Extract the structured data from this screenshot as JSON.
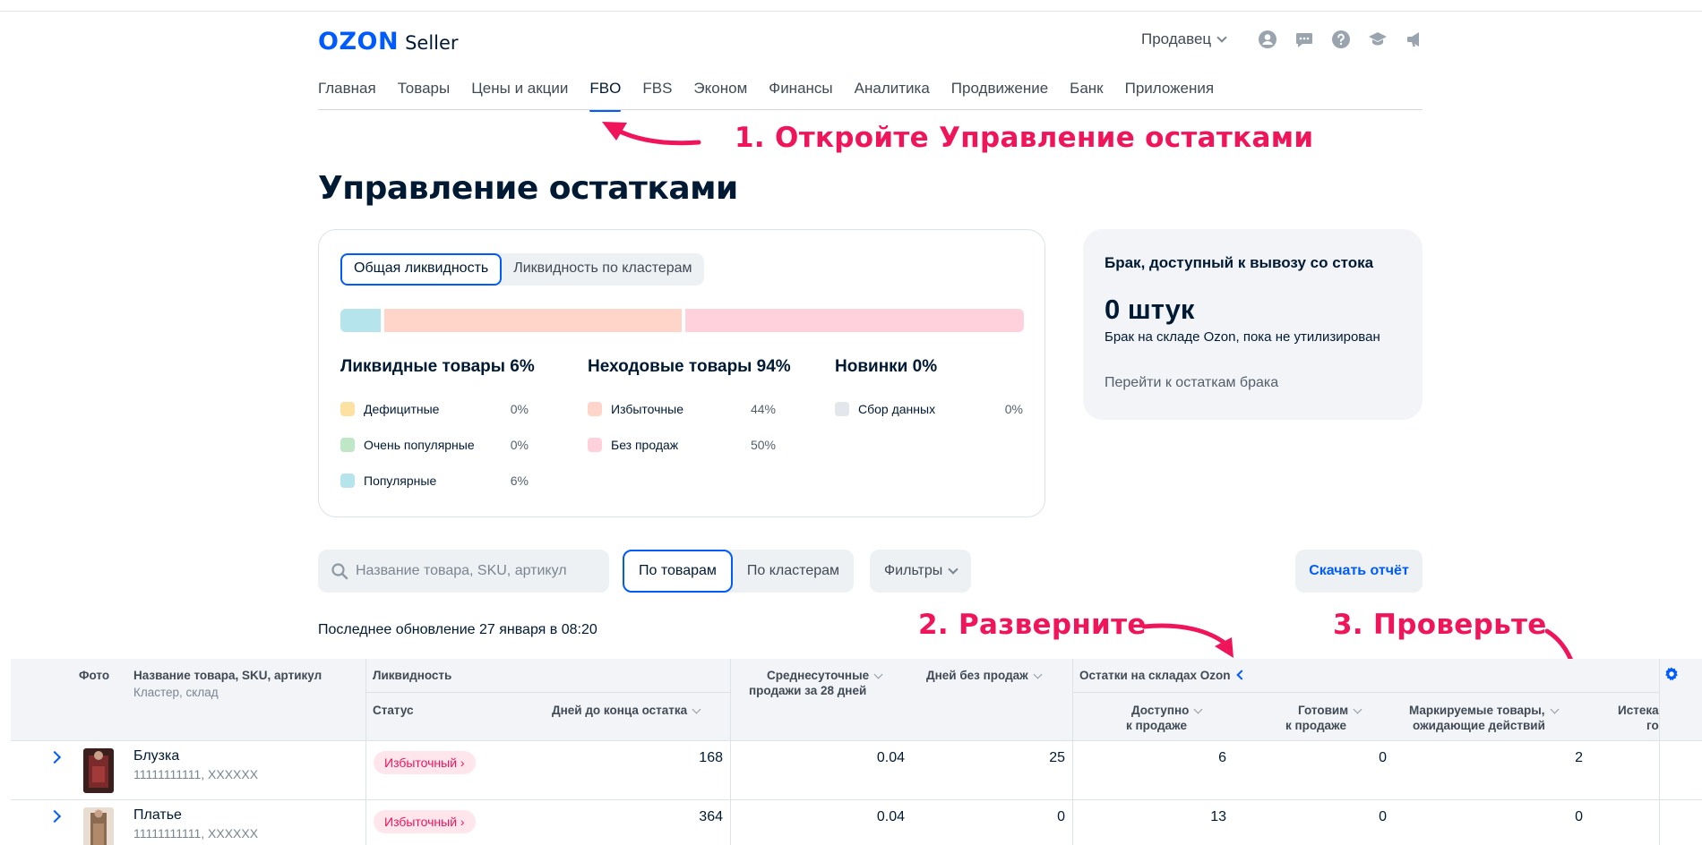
{
  "header": {
    "logo_brand": "OZON",
    "logo_product": "Seller",
    "seller_menu": "Продавец",
    "icons": [
      "user-icon",
      "chat-icon",
      "help-icon",
      "education-icon",
      "announcement-icon"
    ]
  },
  "nav": {
    "items": [
      "Главная",
      "Товары",
      "Цены и акции",
      "FBO",
      "FBS",
      "Эконом",
      "Финансы",
      "Аналитика",
      "Продвижение",
      "Банк",
      "Приложения"
    ],
    "active": "FBO"
  },
  "annotations": {
    "step1": "1. Откройте Управление остатками",
    "step2": "2. Разверните",
    "step3": "3. Проверьте"
  },
  "page": {
    "title": "Управление остатками"
  },
  "liquidity": {
    "tabs": [
      "Общая ликвидность",
      "Ликвидность по кластерам"
    ],
    "active_tab": "Общая ликвидность",
    "bar_segments": [
      {
        "name": "Популярные",
        "fraction": 0.06,
        "color": "#b6e4ec"
      },
      {
        "name": "Избыточные",
        "fraction": 0.44,
        "color": "#ffd4c9"
      },
      {
        "name": "Без продаж",
        "fraction": 0.5,
        "color": "#ffd1dd"
      }
    ],
    "groups": [
      {
        "title": "Ликвидные товары 6%",
        "items": [
          {
            "label": "Дефицитные",
            "pct": "0%",
            "color": "#fde1a0"
          },
          {
            "label": "Очень популярные",
            "pct": "0%",
            "color": "#bfe6c7"
          },
          {
            "label": "Популярные",
            "pct": "6%",
            "color": "#b6e4ec"
          }
        ]
      },
      {
        "title": "Неходовые товары 94%",
        "items": [
          {
            "label": "Избыточные",
            "pct": "44%",
            "color": "#ffd4c9"
          },
          {
            "label": "Без продаж",
            "pct": "50%",
            "color": "#ffd1dd"
          }
        ]
      },
      {
        "title": "Новинки 0%",
        "items": [
          {
            "label": "Сбор данных",
            "pct": "0%",
            "color": "#e3e7eb"
          }
        ]
      }
    ]
  },
  "defect_card": {
    "title": "Брак, доступный к вывозу со стока",
    "value": "0 штук",
    "subtitle": "Брак на складе Ozon, пока не утилизирован",
    "link": "Перейти к остаткам брака"
  },
  "toolbar": {
    "search_placeholder": "Название товара, SKU, артикул",
    "view_options": [
      "По товарам",
      "По кластерам"
    ],
    "view_active": "По товарам",
    "filters_label": "Фильтры",
    "download_label": "Скачать отчёт",
    "updated_text": "Последнее обновление 27 января в 08:20"
  },
  "table": {
    "headers": {
      "photo": "Фото",
      "name": "Название товара, SKU, артикул",
      "name_sub": "Кластер, склад",
      "liquidity": "Ликвидность",
      "status": "Статус",
      "days_left": "Дней до конца остатка",
      "avg_sales_line1": "Среднесуточные",
      "avg_sales_line2": "продажи за 28 дней",
      "days_no_sales": "Дней без продаж",
      "stock_group": "Остатки на складах Ozon",
      "available_line1": "Доступно",
      "available_line2": "к продаже",
      "preparing_line1": "Готовим",
      "preparing_line2": "к продаже",
      "marked_line1": "Маркируемые товары,",
      "marked_line2": "ожидающие действий",
      "expiring_line1": "Истека",
      "expiring_line2": "го"
    },
    "rows": [
      {
        "name": "Блузка",
        "sku": "11111111111, XXXXXX",
        "status": "Избыточный",
        "days_left": "168",
        "avg_sales": "0.04",
        "days_no_sales": "25",
        "available": "6",
        "preparing": "0",
        "marked": "2"
      },
      {
        "name": "Платье",
        "sku": "11111111111, XXXXXX",
        "status": "Избыточный",
        "days_left": "364",
        "avg_sales": "0.04",
        "days_no_sales": "0",
        "available": "13",
        "preparing": "0",
        "marked": "0"
      }
    ]
  }
}
